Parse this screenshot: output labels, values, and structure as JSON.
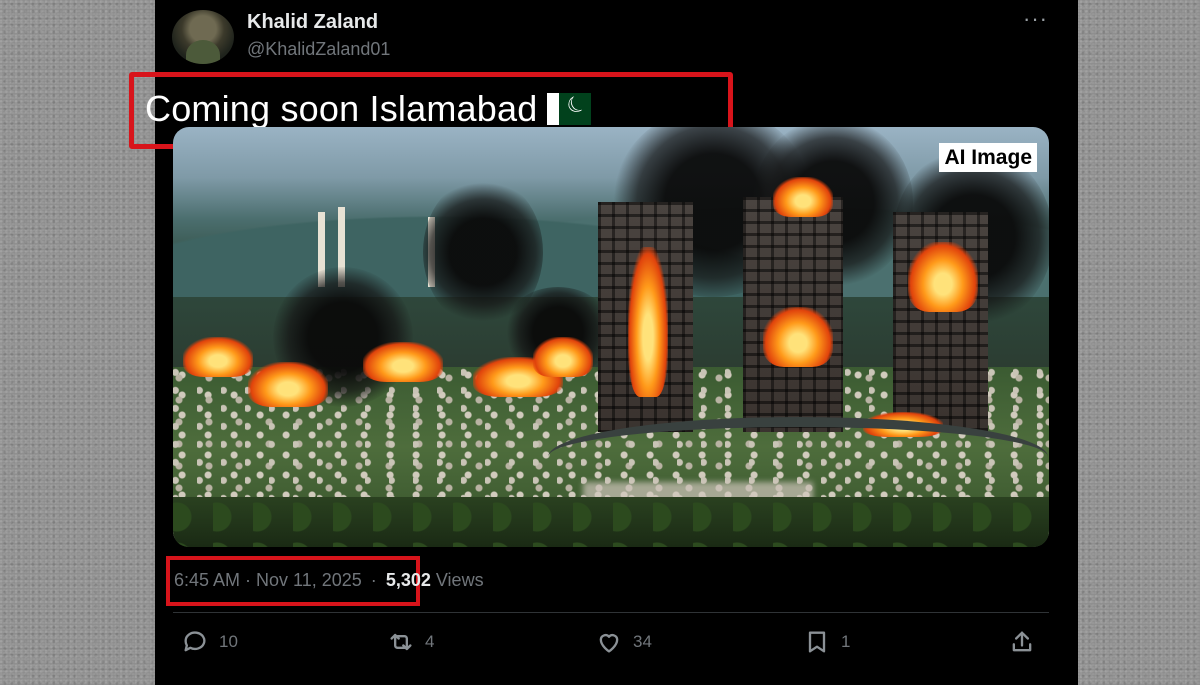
{
  "author": {
    "name": "Khalid Zaland",
    "handle": "@KhalidZaland01"
  },
  "more_icon": "more-horizontal-icon",
  "post_text": "Coming soon Islamabad",
  "post_flag": "pakistan-flag-emoji",
  "media": {
    "label": "AI Image"
  },
  "meta": {
    "timestamp": "6:45 AM · Nov 11, 2025",
    "separator": "·",
    "views_count": "5,302",
    "views_label": "Views"
  },
  "actions": {
    "replies": "10",
    "reposts": "4",
    "likes": "34",
    "bookmarks": "1"
  },
  "colors": {
    "highlight_box": "#d8141b",
    "background": "#000000",
    "muted_text": "#71767b"
  }
}
